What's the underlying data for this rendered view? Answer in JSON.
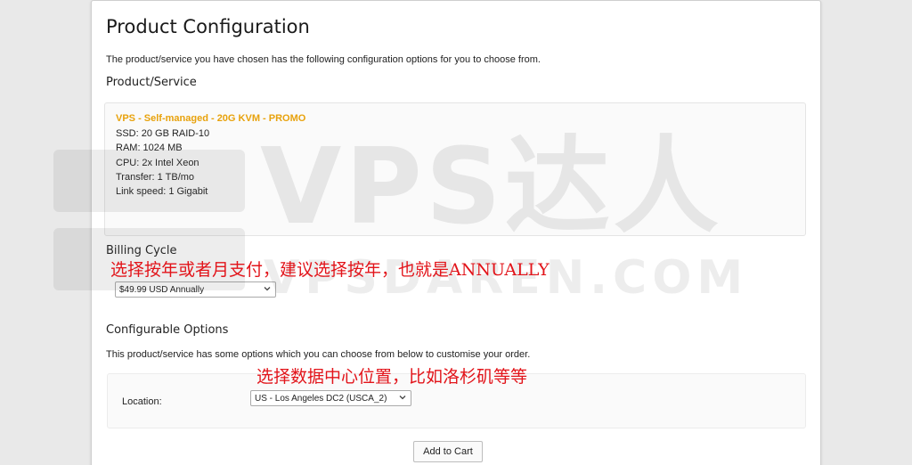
{
  "page": {
    "title": "Product Configuration",
    "intro": "The product/service you have chosen has the following configuration options for you to choose from."
  },
  "product": {
    "section_title": "Product/Service",
    "name": "VPS - Self-managed - 20G KVM - PROMO",
    "specs": [
      "SSD: 20 GB RAID-10",
      "RAM: 1024 MB",
      "CPU: 2x Intel Xeon",
      "Transfer: 1 TB/mo",
      "Link speed: 1 Gigabit"
    ]
  },
  "billing": {
    "section_title": "Billing Cycle",
    "selected": "$49.99 USD Annually"
  },
  "config": {
    "section_title": "Configurable Options",
    "intro": "This product/service has some options which you can choose from below to customise your order.",
    "location_label": "Location:",
    "location_selected": "US - Los Angeles DC2 (USCA_2)"
  },
  "actions": {
    "add_to_cart": "Add to Cart"
  },
  "annotations": {
    "billing_note": "选择按年或者月支付，建议选择按年，也就是ANNUALLY",
    "location_note": "选择数据中心位置，比如洛杉矶等等"
  },
  "watermark": {
    "text": "VPS达人",
    "subtext": "VPSDAREN.COM"
  },
  "colors": {
    "product_name": "#e8a20c",
    "annotation": "#e2141a",
    "background": "#e9e9e9"
  }
}
